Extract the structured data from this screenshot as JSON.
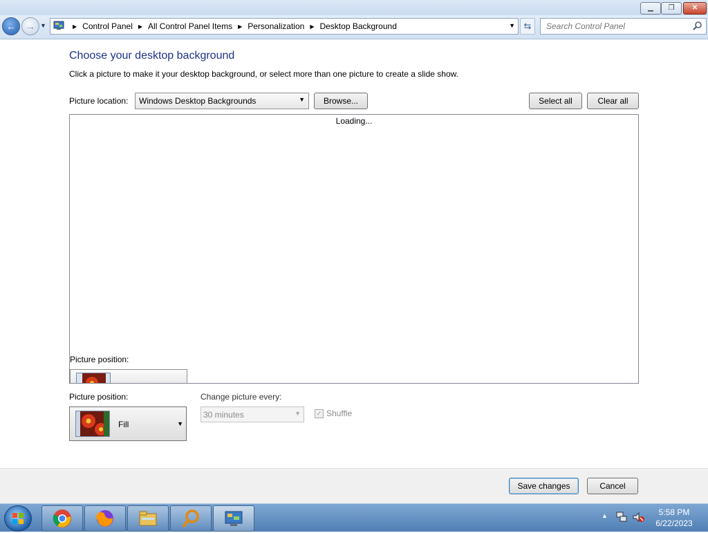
{
  "window": {
    "controls": {
      "minimize": "▁",
      "maximize": "❐",
      "close": "✕"
    }
  },
  "nav": {
    "back_icon": "arrow-left-icon",
    "forward_icon": "arrow-right-icon",
    "breadcrumbs": [
      "Control Panel",
      "All Control Panel Items",
      "Personalization",
      "Desktop Background"
    ],
    "search_placeholder": "Search Control Panel"
  },
  "main": {
    "heading": "Choose your desktop background",
    "subtext": "Click a picture to make it your desktop background, or select more than one picture to create a slide show.",
    "picture_location_label": "Picture location:",
    "picture_location_value": "Windows Desktop Backgrounds",
    "browse_label": "Browse...",
    "select_all_label": "Select all",
    "clear_all_label": "Clear all",
    "loading_text": "Loading...",
    "ghost_position_label": "Picture position:",
    "picture_position_label": "Picture position:",
    "picture_position_value": "Fill",
    "change_every_label": "Change picture every:",
    "change_every_value": "30 minutes",
    "shuffle_label": "Shuffle",
    "shuffle_checked": true
  },
  "footer": {
    "save_label": "Save changes",
    "cancel_label": "Cancel"
  },
  "taskbar": {
    "apps": [
      "chrome-icon",
      "firefox-icon",
      "file-explorer-icon",
      "search-magnifier-icon",
      "control-panel-icon"
    ],
    "time": "5:58 PM",
    "date": "6/22/2023"
  },
  "colors": {
    "heading": "#1e3287",
    "accent": "#3c7fb1",
    "taskbar": "#4f7fb5"
  }
}
